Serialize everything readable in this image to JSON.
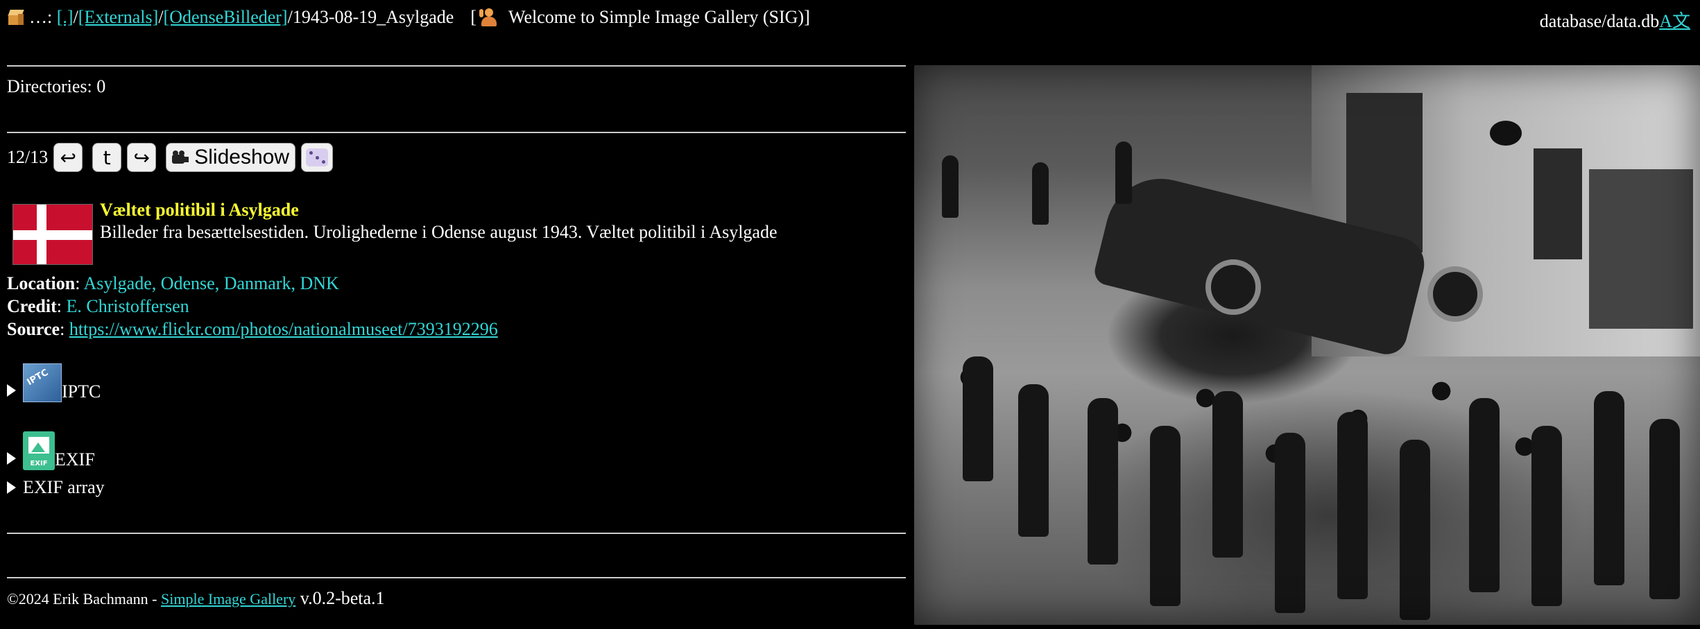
{
  "breadcrumb": {
    "prefix": "…:",
    "links": [
      "[.]",
      "[Externals]",
      "[OdenseBilleder]"
    ],
    "sep": "/",
    "current": "/1943-08-19_Asylgade",
    "welcome_open": "[",
    "welcome_text": "Welcome to Simple Image Gallery (SIG)]"
  },
  "header": {
    "db_path": "database/data.db",
    "lang_link": "A文"
  },
  "directories_label": "Directories: 0",
  "nav": {
    "position": "12/13",
    "prev": "↩",
    "up": "t",
    "next": "↪",
    "slideshow": "Slideshow"
  },
  "image": {
    "title": "Væltet politibil i Asylgade",
    "description": "Billeder fra besættelsestiden. Urolighederne i Odense august 1943. Væltet politibil i Asylgade",
    "flag_country": "Denmark"
  },
  "meta": {
    "location_label": "Location",
    "location_value": "Asylgade, Odense, Danmark, DNK",
    "credit_label": "Credit",
    "credit_value": "E. Christoffersen",
    "source_label": "Source",
    "source_value": "https://www.flickr.com/photos/nationalmuseet/7393192296"
  },
  "sections": {
    "iptc": "IPTC",
    "iptc_icon_text": "IPTC",
    "exif": "EXIF",
    "exif_icon_text": "EXIF",
    "exif_array": "EXIF array"
  },
  "footer": {
    "copyright": "©2024 Erik Bachmann - ",
    "link": "Simple Image Gallery",
    "version": " v.0.2-beta.1"
  },
  "colors": {
    "background": "#000000",
    "link": "#33d6d6",
    "title": "#ffff33",
    "flag_red": "#c8102e"
  }
}
